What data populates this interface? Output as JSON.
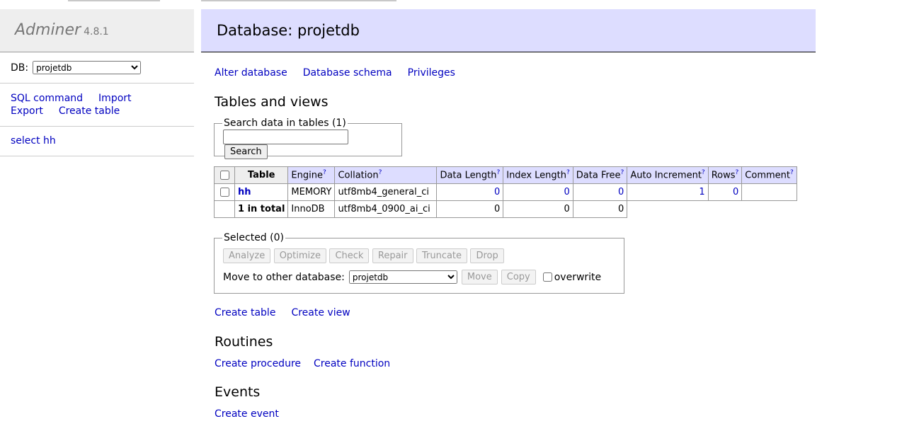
{
  "app": {
    "name": "Adminer",
    "version": "4.8.1"
  },
  "sidebar": {
    "db_label": "DB:",
    "db_selected": "projetdb",
    "links": [
      "SQL command",
      "Import",
      "Export",
      "Create table"
    ],
    "table_link": "select hh"
  },
  "header": {
    "title": "Database: projetdb"
  },
  "db_links": [
    "Alter database",
    "Database schema",
    "Privileges"
  ],
  "tables_section": {
    "heading": "Tables and views",
    "search_legend": "Search data in tables (1)",
    "search_value": "",
    "search_button": "Search"
  },
  "table": {
    "headers": [
      "Table",
      "Engine",
      "Collation",
      "Data Length",
      "Index Length",
      "Data Free",
      "Auto Increment",
      "Rows",
      "Comment"
    ],
    "help_mark": "?",
    "rows": [
      {
        "name": "hh",
        "engine": "MEMORY",
        "collation": "utf8mb4_general_ci",
        "data_length": "0",
        "index_length": "0",
        "data_free": "0",
        "auto_increment": "1",
        "rows": "0",
        "comment": ""
      }
    ],
    "total": {
      "name": "1 in total",
      "engine": "InnoDB",
      "collation": "utf8mb4_0900_ai_ci",
      "data_length": "0",
      "index_length": "0",
      "data_free": "0"
    }
  },
  "selected": {
    "legend": "Selected (0)",
    "buttons": [
      "Analyze",
      "Optimize",
      "Check",
      "Repair",
      "Truncate",
      "Drop"
    ],
    "move_label": "Move to other database:",
    "move_target": "projetdb",
    "move_button": "Move",
    "copy_button": "Copy",
    "overwrite_label": "overwrite"
  },
  "create_links": [
    "Create table",
    "Create view"
  ],
  "routines": {
    "heading": "Routines",
    "links": [
      "Create procedure",
      "Create function"
    ]
  },
  "events": {
    "heading": "Events",
    "links": [
      "Create event"
    ]
  },
  "colors": {
    "header_bg": "#ddf",
    "link": "#0000c0",
    "sidebar_bg": "#eee"
  }
}
